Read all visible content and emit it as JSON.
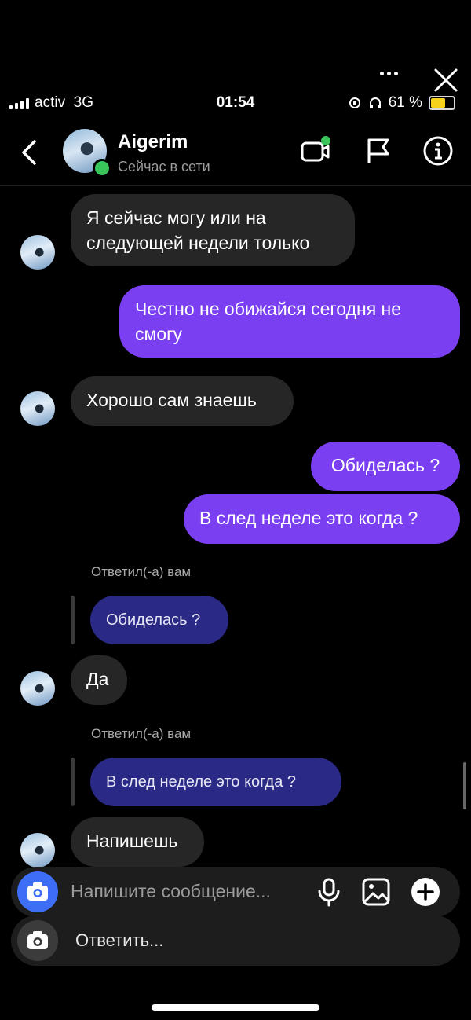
{
  "status_bar": {
    "carrier": "activ",
    "network": "3G",
    "time": "01:54",
    "battery": "61 %"
  },
  "header": {
    "name": "Aigerim",
    "status": "Сейчас в сети",
    "online_color": "#3ac55a"
  },
  "colors": {
    "outgoing": "#7b3ff2",
    "incoming": "#262626",
    "quoted": "#2a2a86",
    "camera_button": "#3d6ef5"
  },
  "messages": {
    "m1": "Я сейчас могу или на следующей недели только",
    "m2": "Честно не обижайся сегодня не смогу",
    "m3": "Хорошо сам знаешь",
    "m4": "Обиделась ?",
    "m5": "В след неделе это когда ?",
    "reply1_note": "Ответил(-а) вам",
    "reply1_quote": "Обиделась ?",
    "m6": "Да",
    "reply2_note": "Ответил(-а) вам",
    "reply2_quote": "В след неделе это когда ?",
    "m7": "Напишешь"
  },
  "composer": {
    "placeholder": "Напишите сообщение...",
    "quick_reply": "Ответить..."
  },
  "icons": [
    "more-icon",
    "close-icon",
    "back-icon",
    "video-call-icon",
    "flag-icon",
    "info-icon",
    "camera-icon",
    "microphone-icon",
    "gallery-icon",
    "plus-icon"
  ]
}
